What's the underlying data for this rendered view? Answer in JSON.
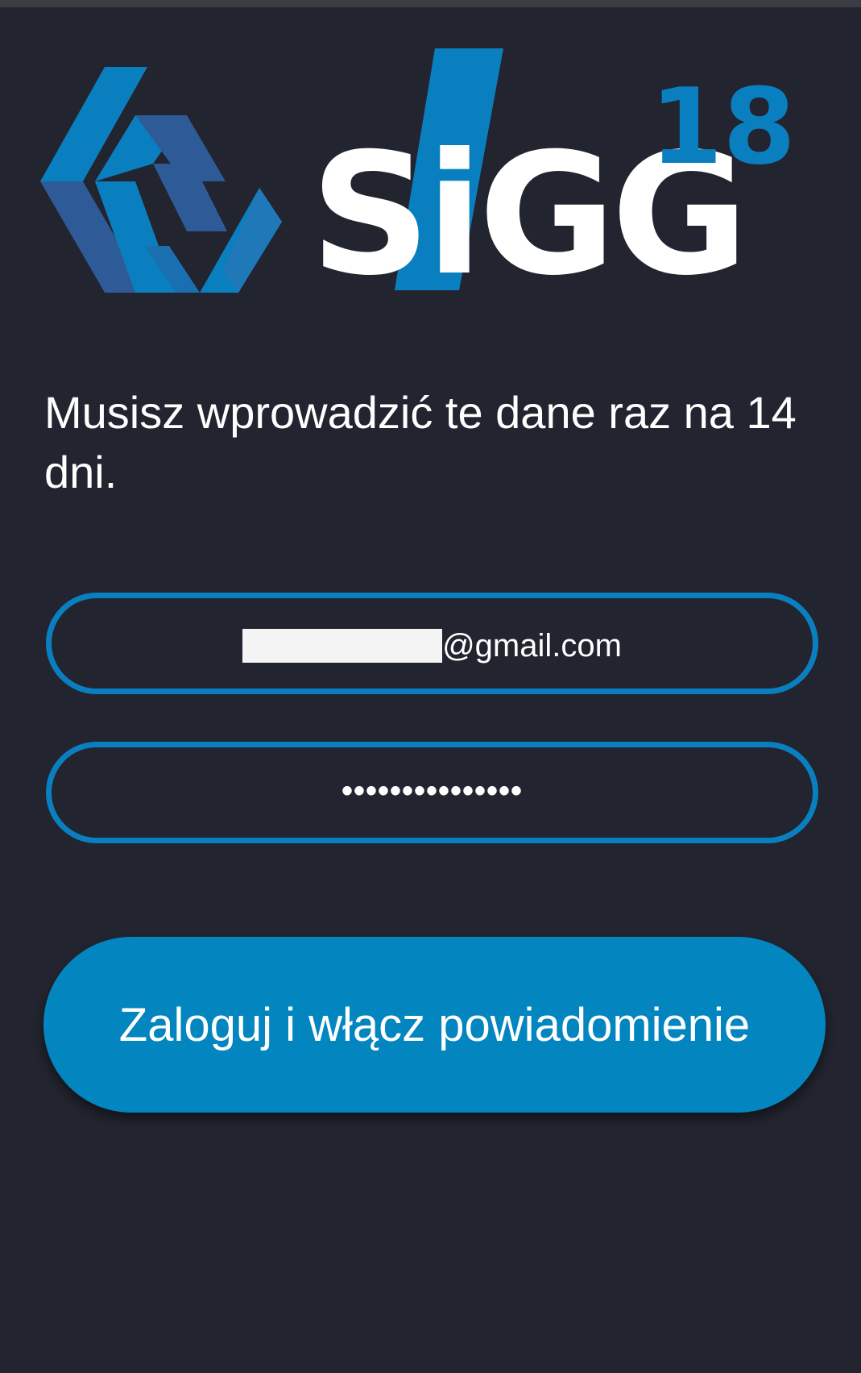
{
  "logo": {
    "brand_text": "SIGG",
    "superscript": "18",
    "colors": {
      "primary_blue": "#0a7fc0",
      "dark_blue": "#2e5a98",
      "white": "#ffffff"
    }
  },
  "info_text": "Musisz wprowadzić te dane raz na 14 dni.",
  "email_field": {
    "value_suffix": "@gmail.com",
    "redacted": true
  },
  "password_field": {
    "masked_value": "•••••••••••••••"
  },
  "login_button": {
    "label": "Zaloguj i włącz powiadomienie"
  },
  "colors": {
    "background": "#22242f",
    "accent": "#0a7fc0",
    "button": "#0385c0",
    "text": "#ffffff"
  }
}
